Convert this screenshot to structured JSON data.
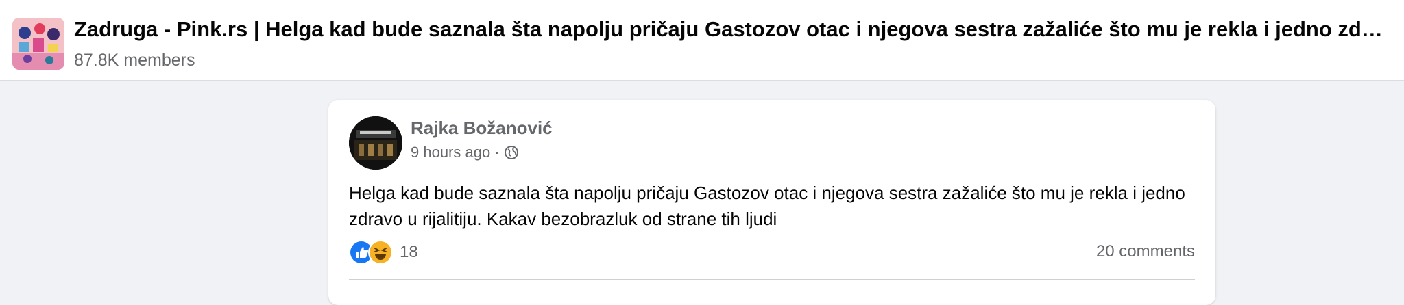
{
  "group": {
    "name": "Zadruga - Pink.rs | Helga kad bude saznala šta napolju pričaju Gastozov otac i njegova sestra zažaliće što mu je rekla i jedno zdravo u rijalitiju. Kakav bezobrazluk od strane tih ljudi",
    "members": "87.8K members",
    "avatar_icon": "group-collage-icon"
  },
  "post": {
    "author": "Rajka Božanović",
    "time": "9 hours ago",
    "separator": "·",
    "audience_icon": "globe-icon",
    "text": "Helga kad bude saznala šta napolju pričaju Gastozov otac i njegova sestra zažaliće što mu je rekla i jedno zdravo u rijalitiju. Kakav bezobrazluk od strane tih ljudi",
    "reactions": {
      "icons": [
        "like-icon",
        "haha-icon"
      ],
      "count": "18"
    },
    "comments": "20 comments"
  },
  "colors": {
    "background": "#f0f2f5",
    "card": "#ffffff",
    "secondary_text": "#65676b",
    "like_blue": "#1877f2",
    "haha_yellow": "#f7b125"
  }
}
